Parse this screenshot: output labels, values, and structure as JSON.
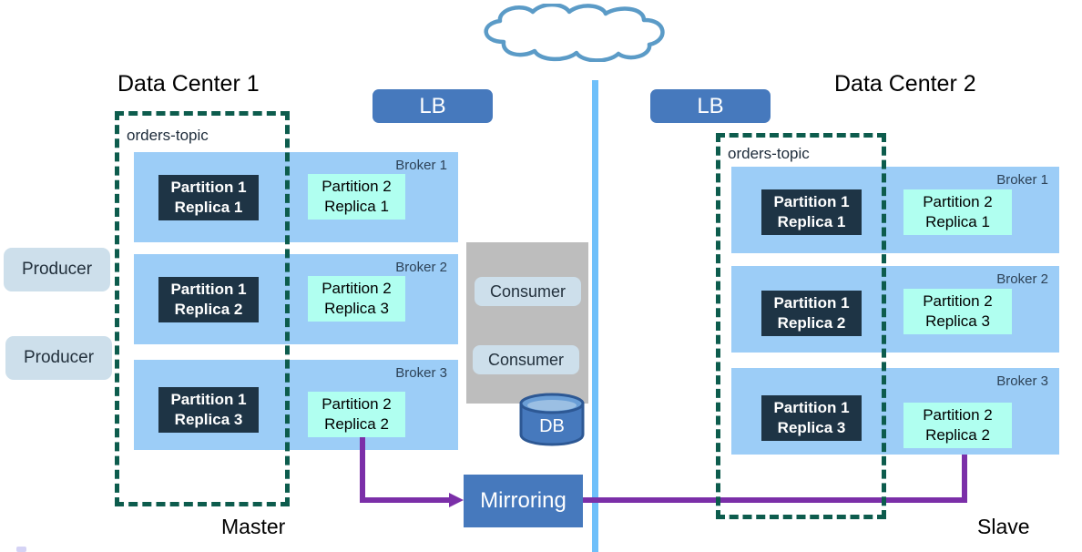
{
  "diagram": {
    "title_left": "Data Center 1",
    "title_right": "Data Center 2",
    "role_left": "Master",
    "role_right": "Slave",
    "cloud": "cloud-icon",
    "colors": {
      "broker_fill": "#9ccdf7",
      "replica_leader": "#1e3445",
      "replica_follower": "#b0fff0",
      "topic_border": "#0d5c4d",
      "lb_fill": "#4679bd",
      "mirroring_fill": "#4679bd",
      "producer_fill": "#cddfeb",
      "consumer_panel": "#bdbdbd",
      "divider": "#6fc0fa",
      "arrow": "#7b2fa8",
      "db_fill": "#4679bd"
    }
  },
  "producers": [
    {
      "label": "Producer"
    },
    {
      "label": "Producer"
    }
  ],
  "load_balancers": [
    {
      "label": "LB"
    },
    {
      "label": "LB"
    }
  ],
  "left_dc": {
    "topic_label": "orders-topic",
    "brokers": [
      {
        "name": "Broker 1",
        "leader": {
          "line1": "Partition 1",
          "line2": "Replica 1"
        },
        "follower": {
          "line1": "Partition 2",
          "line2": "Replica 1"
        }
      },
      {
        "name": "Broker 2",
        "leader": {
          "line1": "Partition 1",
          "line2": "Replica 2"
        },
        "follower": {
          "line1": "Partition 2",
          "line2": "Replica 3"
        }
      },
      {
        "name": "Broker 3",
        "leader": {
          "line1": "Partition 1",
          "line2": "Replica 3"
        },
        "follower": {
          "line1": "Partition 2",
          "line2": "Replica 2"
        }
      }
    ]
  },
  "right_dc": {
    "topic_label": "orders-topic",
    "brokers": [
      {
        "name": "Broker 1",
        "leader": {
          "line1": "Partition 1",
          "line2": "Replica 1"
        },
        "follower": {
          "line1": "Partition 2",
          "line2": "Replica 1"
        }
      },
      {
        "name": "Broker 2",
        "leader": {
          "line1": "Partition 1",
          "line2": "Replica 2"
        },
        "follower": {
          "line1": "Partition 2",
          "line2": "Replica 3"
        }
      },
      {
        "name": "Broker 3",
        "leader": {
          "line1": "Partition 1",
          "line2": "Replica 3"
        },
        "follower": {
          "line1": "Partition 2",
          "line2": "Replica 2"
        }
      }
    ]
  },
  "center": {
    "consumers": [
      {
        "label": "Consumer"
      },
      {
        "label": "Consumer"
      }
    ],
    "database": {
      "label": "DB"
    },
    "mirroring": {
      "label": "Mirroring"
    }
  }
}
